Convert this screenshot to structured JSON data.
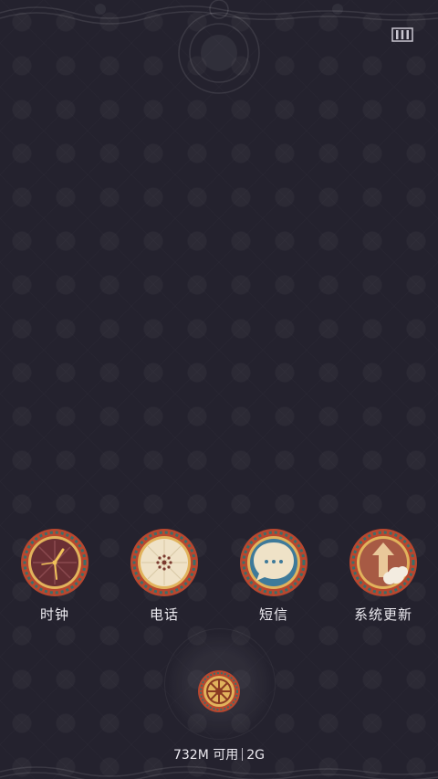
{
  "theme": {
    "background": "#24222e",
    "badge_rim_outer": "#b8472f",
    "badge_rim_inner": "#3a6f6a",
    "badge_gold": "#e1b35c",
    "label_color": "#eceaf0"
  },
  "status": {
    "menu_icon": "menu-bars-icon"
  },
  "dock": {
    "apps": [
      {
        "label": "时钟",
        "icon": "clock-icon"
      },
      {
        "label": "电话",
        "icon": "phone-icon"
      },
      {
        "label": "短信",
        "icon": "message-icon"
      },
      {
        "label": "系统更新",
        "icon": "system-update-icon"
      }
    ]
  },
  "center_button": {
    "icon": "dharma-wheel-icon"
  },
  "memory": {
    "available": "732M 可用",
    "total": "2G"
  }
}
